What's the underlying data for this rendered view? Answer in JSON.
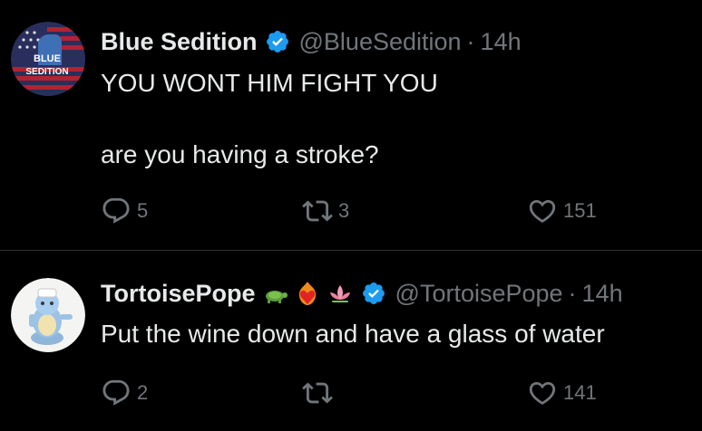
{
  "tweets": [
    {
      "name": "Blue Sedition",
      "handle": "@BlueSedition",
      "separator": "·",
      "time": "14h",
      "avatar_text": [
        "BLUE",
        "SEDITION"
      ],
      "text_lines": [
        "YOU WONT HIM FIGHT YOU",
        "are you having a stroke?"
      ],
      "replies": "5",
      "retweets": "3",
      "likes": "151"
    },
    {
      "name": "TortoisePope",
      "handle": "@TortoisePope",
      "separator": "·",
      "time": "14h",
      "name_emojis": [
        "turtle-emoji",
        "heart-on-fire-emoji",
        "lotus-emoji"
      ],
      "text_lines": [
        "Put the wine down and have a glass of water"
      ],
      "replies": "2",
      "retweets": "",
      "likes": "141"
    }
  ],
  "icons": [
    "reply-icon",
    "retweet-icon",
    "like-icon",
    "verified-badge-icon"
  ],
  "colors": {
    "background": "#000000",
    "text": "#e7e9ea",
    "muted": "#71767b",
    "verified": "#1d9bf0",
    "divider": "#2f3336"
  }
}
